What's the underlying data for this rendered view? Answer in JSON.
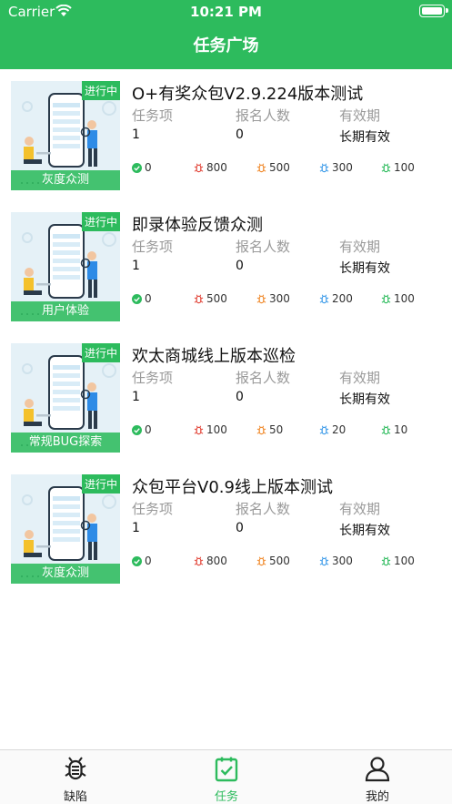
{
  "status_bar": {
    "carrier": "Carrier",
    "time": "10:21 PM"
  },
  "nav": {
    "title": "任务广场"
  },
  "columns": {
    "tasks": "任务项",
    "signups": "报名人数",
    "validity": "有效期"
  },
  "colors": {
    "brand": "#2dbb5d",
    "sev_critical": "#e2463a",
    "sev_major": "#f08a2c",
    "sev_normal": "#3d9be9",
    "sev_minor": "#2dbb5d"
  },
  "tasks": [
    {
      "status": "进行中",
      "category": "灰度众测",
      "title": "O+有奖众包V2.9.224版本测试",
      "task_count": "1",
      "signups": "0",
      "validity": "长期有效",
      "stats": [
        "0",
        "800",
        "500",
        "300",
        "100"
      ]
    },
    {
      "status": "进行中",
      "category": "用户体验",
      "title": "即录体验反馈众测",
      "task_count": "1",
      "signups": "0",
      "validity": "长期有效",
      "stats": [
        "0",
        "500",
        "300",
        "200",
        "100"
      ]
    },
    {
      "status": "进行中",
      "category": "常规BUG探索",
      "title": "欢太商城线上版本巡检",
      "task_count": "1",
      "signups": "0",
      "validity": "长期有效",
      "stats": [
        "0",
        "100",
        "50",
        "20",
        "10"
      ]
    },
    {
      "status": "进行中",
      "category": "灰度众测",
      "title": "众包平台V0.9线上版本测试",
      "task_count": "1",
      "signups": "0",
      "validity": "长期有效",
      "stats": [
        "0",
        "800",
        "500",
        "300",
        "100"
      ]
    }
  ],
  "tabs": [
    {
      "label": "缺陷",
      "icon": "bug-icon"
    },
    {
      "label": "任务",
      "icon": "task-clipboard-icon"
    },
    {
      "label": "我的",
      "icon": "profile-icon"
    }
  ]
}
